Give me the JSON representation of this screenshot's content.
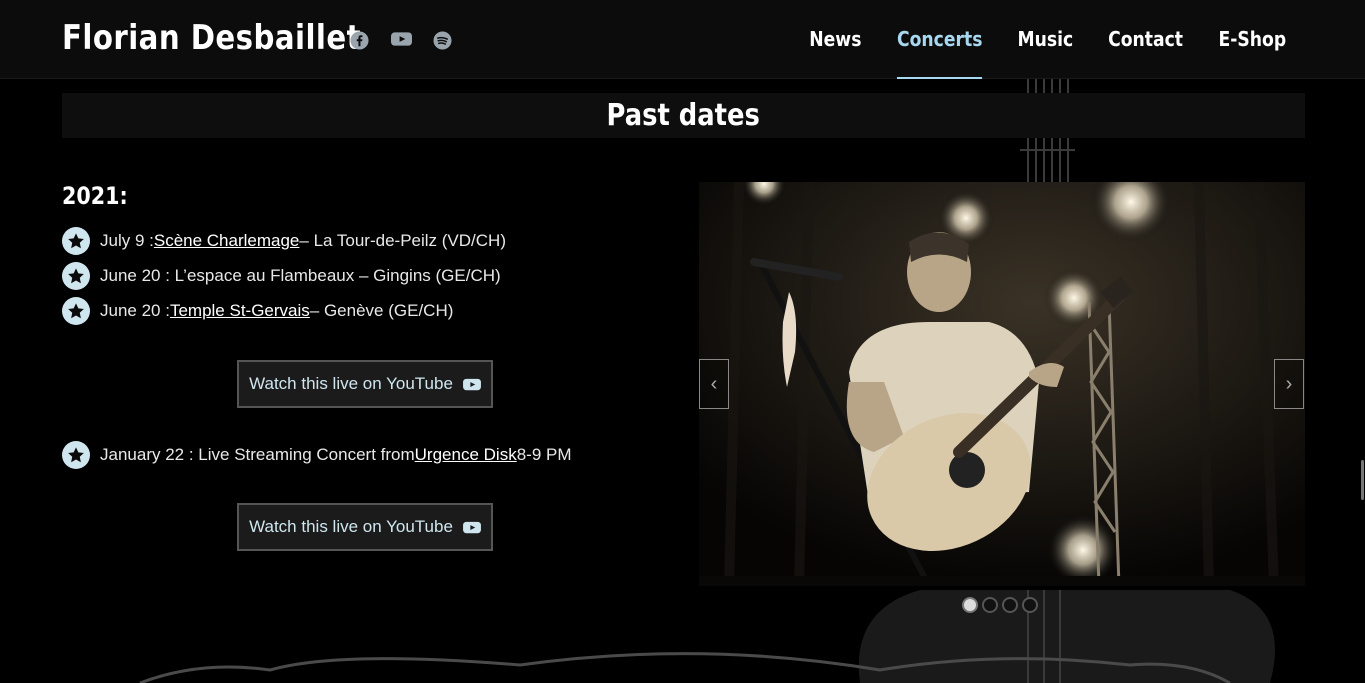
{
  "site": {
    "title": "Florian Desbaillet",
    "social": [
      {
        "name": "facebook-icon"
      },
      {
        "name": "youtube-icon"
      },
      {
        "name": "spotify-icon"
      }
    ]
  },
  "nav": {
    "items": [
      {
        "label": "News"
      },
      {
        "label": "Concerts"
      },
      {
        "label": "Music"
      },
      {
        "label": "Contact"
      },
      {
        "label": "E-Shop"
      }
    ],
    "active": "Concerts"
  },
  "section": {
    "title": "Past dates",
    "year": "2021:"
  },
  "concerts": [
    {
      "date": "July 9 : ",
      "link": "Scène Charlemage",
      "rest": " – La Tour-de-Peilz (VD/CH)"
    },
    {
      "date": "June 20 : L’espace au Flambeaux – Gingins (GE/CH)",
      "link": "",
      "rest": ""
    },
    {
      "date": "June 20 : ",
      "link": "Temple St-Gervais",
      "rest": " – Genève (GE/CH)"
    },
    {
      "date": "January 22 : Live Streaming Concert from ",
      "link": "Urgence Disk",
      "rest": " 8-9 PM"
    }
  ],
  "buttons": {
    "youtube_label": "Watch this live on YouTube"
  },
  "slideshow": {
    "prev": "‹",
    "next": "›",
    "slide_count": 4,
    "active_index": 0
  },
  "colors": {
    "accent": "#a8d8ef",
    "background": "#000000"
  }
}
